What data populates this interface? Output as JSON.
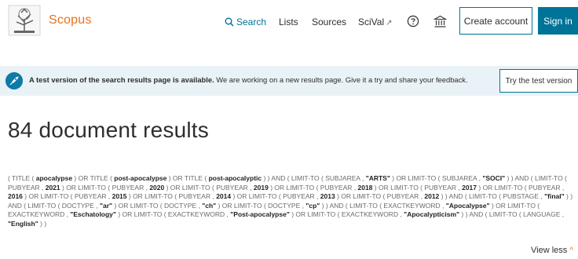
{
  "header": {
    "brand": "Scopus",
    "nav": {
      "search": "Search",
      "lists": "Lists",
      "sources": "Sources",
      "scival": "SciVal",
      "scival_ext": "↗"
    },
    "create_account": "Create account",
    "sign_in": "Sign in",
    "accent": "#007398",
    "brand_color": "#e9711c"
  },
  "banner": {
    "bold": "A test version of the search results page is available.",
    "text": " We are working on a new results page. Give it a try and share your feedback.",
    "button": "Try the test version",
    "background": "#e9f2f7"
  },
  "results": {
    "title": "84 document results"
  },
  "query": {
    "segments": [
      [
        "( TITLE ( ",
        0
      ],
      [
        "apocalypse",
        1
      ],
      [
        " ) OR TITLE ( ",
        0
      ],
      [
        "post-apocalypse",
        1
      ],
      [
        " ) OR TITLE ( ",
        0
      ],
      [
        "post-apocalyptic",
        1
      ],
      [
        " ) ) AND ( LIMIT-TO ( SUBJAREA , ",
        0
      ],
      [
        "\"ARTS\"",
        1
      ],
      [
        " ) OR LIMIT-TO ( SUBJAREA , ",
        0
      ],
      [
        "\"SOCI\"",
        1
      ],
      [
        " ) ) AND ( LIMIT-TO ( PUBYEAR , ",
        0
      ],
      [
        "2021",
        1
      ],
      [
        " ) OR LIMIT-TO ( PUBYEAR , ",
        0
      ],
      [
        "2020",
        1
      ],
      [
        " ) OR LIMIT-TO ( PUBYEAR , ",
        0
      ],
      [
        "2019",
        1
      ],
      [
        " ) OR LIMIT-TO ( PUBYEAR , ",
        0
      ],
      [
        "2018",
        1
      ],
      [
        " ) OR LIMIT-TO ( PUBYEAR , ",
        0
      ],
      [
        "2017",
        1
      ],
      [
        " ) OR LIMIT-TO ( PUBYEAR , ",
        0
      ],
      [
        "2016",
        1
      ],
      [
        " ) OR LIMIT-TO ( PUBYEAR , ",
        0
      ],
      [
        "2015",
        1
      ],
      [
        " ) OR LIMIT-TO ( PUBYEAR , ",
        0
      ],
      [
        "2014",
        1
      ],
      [
        " ) OR LIMIT-TO ( PUBYEAR , ",
        0
      ],
      [
        "2013",
        1
      ],
      [
        " ) OR LIMIT-TO ( PUBYEAR , ",
        0
      ],
      [
        "2012",
        1
      ],
      [
        " ) ) AND ( LIMIT-TO ( PUBSTAGE , ",
        0
      ],
      [
        "\"final\"",
        1
      ],
      [
        " ) ) AND ( LIMIT-TO ( DOCTYPE , ",
        0
      ],
      [
        "\"ar\"",
        1
      ],
      [
        " ) OR LIMIT-TO ( DOCTYPE , ",
        0
      ],
      [
        "\"ch\"",
        1
      ],
      [
        " ) OR LIMIT-TO ( DOCTYPE , ",
        0
      ],
      [
        "\"cp\"",
        1
      ],
      [
        " ) ) AND ( LIMIT-TO ( EXACTKEYWORD , ",
        0
      ],
      [
        "\"Apocalypse\"",
        1
      ],
      [
        " ) OR LIMIT-TO ( EXACTKEYWORD , ",
        0
      ],
      [
        "\"Eschatology\"",
        1
      ],
      [
        " ) OR LIMIT-TO ( EXACTKEYWORD , ",
        0
      ],
      [
        "\"Post-apocalypse\"",
        1
      ],
      [
        " ) OR LIMIT-TO ( EXACTKEYWORD , ",
        0
      ],
      [
        "\"Apocalypticism\"",
        1
      ],
      [
        " ) ) AND ( LIMIT-TO ( LANGUAGE , ",
        0
      ],
      [
        "\"English\"",
        1
      ],
      [
        " ) )",
        0
      ]
    ],
    "view_less": "View less",
    "chevron": "^"
  }
}
